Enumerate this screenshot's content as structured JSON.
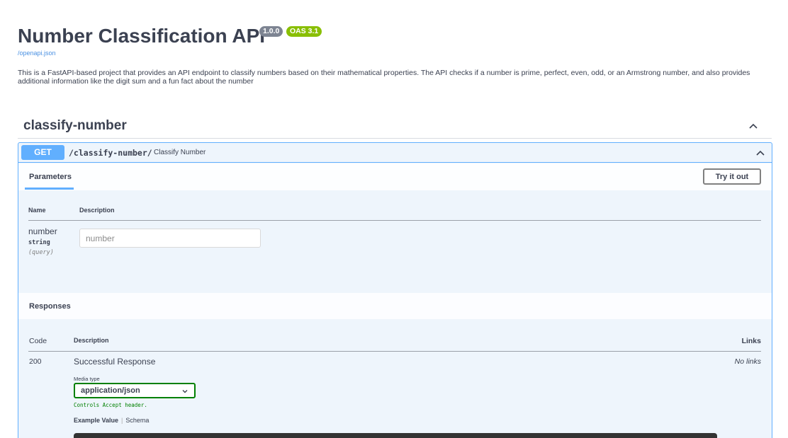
{
  "info": {
    "title": "Number Classification API",
    "version": "1.0.0",
    "oas": "OAS 3.1",
    "spec_link": "/openapi.json",
    "description": "This is a FastAPI-based project that provides an API endpoint to classify numbers based on their mathematical properties. The API checks if a number is prime, perfect, even, odd, or an Armstrong number, and also provides additional information like the digit sum and a fun fact about the number"
  },
  "tag": {
    "name": "classify-number",
    "icon": "chevron-up-icon"
  },
  "operation": {
    "method": "GET",
    "path": "/classify-number/",
    "summary": "Classify Number",
    "parameters_tab": "Parameters",
    "try_button": "Try it out",
    "col_name": "Name",
    "col_description": "Description",
    "param": {
      "name": "number",
      "type": "string",
      "in": "(query)",
      "placeholder": "number"
    },
    "responses": {
      "title": "Responses",
      "col_code": "Code",
      "col_description": "Description",
      "col_links": "Links",
      "code": "200",
      "description": "Successful Response",
      "links": "No links",
      "media_label": "Media type",
      "media_value": "application/json",
      "accept_note": "Controls Accept header.",
      "tab_example": "Example Value",
      "tab_schema": "Schema"
    }
  },
  "colors": {
    "get": "#61affe",
    "oas": "#89bf04",
    "version": "#7d8492",
    "media_border": "#008000"
  }
}
